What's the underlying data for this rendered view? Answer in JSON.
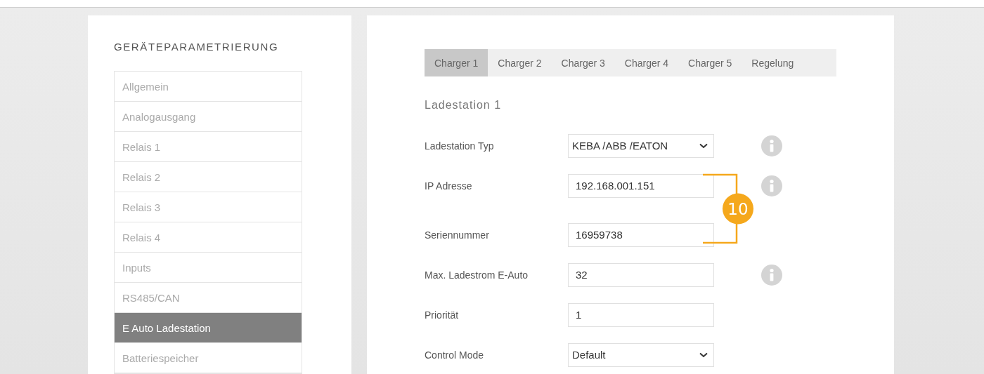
{
  "sidebar": {
    "title": "GERÄTEPARAMETRIERUNG",
    "items": [
      {
        "label": "Allgemein",
        "selected": false
      },
      {
        "label": "Analogausgang",
        "selected": false
      },
      {
        "label": "Relais 1",
        "selected": false
      },
      {
        "label": "Relais 2",
        "selected": false
      },
      {
        "label": "Relais 3",
        "selected": false
      },
      {
        "label": "Relais 4",
        "selected": false
      },
      {
        "label": "Inputs",
        "selected": false
      },
      {
        "label": "RS485/CAN",
        "selected": false
      },
      {
        "label": "E Auto Ladestation",
        "selected": true
      },
      {
        "label": "Batteriespeicher",
        "selected": false
      }
    ]
  },
  "tabs": [
    {
      "label": "Charger 1",
      "selected": true
    },
    {
      "label": "Charger 2",
      "selected": false
    },
    {
      "label": "Charger 3",
      "selected": false
    },
    {
      "label": "Charger 4",
      "selected": false
    },
    {
      "label": "Charger 5",
      "selected": false
    },
    {
      "label": "Regelung",
      "selected": false
    }
  ],
  "section_title": "Ladestation 1",
  "annotation": {
    "label": "10"
  },
  "fields": [
    {
      "label": "Ladestation Typ",
      "kind": "select",
      "value": "KEBA /ABB /EATON",
      "info": true,
      "annotated": false
    },
    {
      "label": "IP Adresse",
      "kind": "input",
      "value": "192.168.001.151",
      "info": true,
      "annotated": true
    },
    {
      "label": "Seriennummer",
      "kind": "input",
      "value": "16959738",
      "info": false,
      "annotated": true
    },
    {
      "label": "Max. Ladestrom E-Auto",
      "kind": "input",
      "value": "32",
      "info": true,
      "annotated": false
    },
    {
      "label": "Priorität",
      "kind": "input",
      "value": "1",
      "info": false,
      "annotated": false
    },
    {
      "label": "Control Mode",
      "kind": "select",
      "value": "Default",
      "info": false,
      "annotated": false
    }
  ]
}
